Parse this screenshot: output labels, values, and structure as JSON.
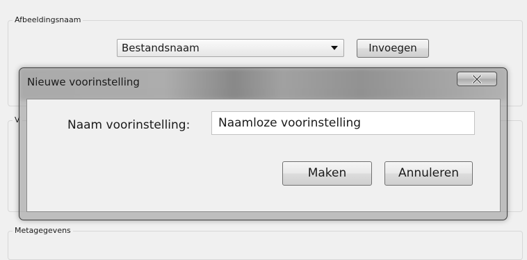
{
  "background": {
    "image_name_group": {
      "legend": "Afbeeldingsnaam",
      "select_value": "Bestandsnaam",
      "insert_label": "Invoegen"
    },
    "middle_group": {
      "legend": "V"
    },
    "metadata_group": {
      "legend": "Metagegevens"
    }
  },
  "dialog": {
    "title": "Nieuwe voorinstelling",
    "close_icon": "close-icon",
    "name_label": "Naam voorinstelling:",
    "name_value": "Naamloze voorinstelling",
    "create_label": "Maken",
    "cancel_label": "Annuleren"
  },
  "colors": {
    "window_bg": "#f0f0f0",
    "dialog_frame": "#3b3b3b",
    "input_bg": "#ffffff"
  }
}
